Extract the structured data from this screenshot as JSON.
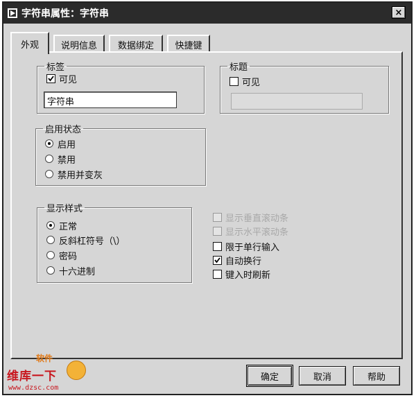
{
  "window": {
    "title": "字符串属性：字符串",
    "close_glyph": "×"
  },
  "tabs": [
    {
      "label": "外观"
    },
    {
      "label": "说明信息"
    },
    {
      "label": "数据绑定"
    },
    {
      "label": "快捷键"
    }
  ],
  "label_group": {
    "legend": "标签",
    "visible_label": "可见",
    "visible_checked": true,
    "value": "字符串"
  },
  "caption_group": {
    "legend": "标题",
    "visible_label": "可见",
    "visible_checked": false,
    "value": ""
  },
  "enable_group": {
    "legend": "启用状态",
    "options": [
      "启用",
      "禁用",
      "禁用并变灰"
    ],
    "selected": "启用"
  },
  "display_group": {
    "legend": "显示样式",
    "options": [
      "正常",
      "反斜杠符号（\\）",
      "密码",
      "十六进制"
    ],
    "selected": "正常"
  },
  "options": [
    {
      "label": "显示垂直滚动条",
      "checked": false,
      "enabled": false
    },
    {
      "label": "显示水平滚动条",
      "checked": false,
      "enabled": false
    },
    {
      "label": "限于单行输入",
      "checked": false,
      "enabled": true
    },
    {
      "label": "自动换行",
      "checked": true,
      "enabled": true
    },
    {
      "label": "键入时刷新",
      "checked": false,
      "enabled": true
    }
  ],
  "buttons": {
    "ok": "确定",
    "cancel": "取消",
    "help": "帮助"
  },
  "watermark": {
    "top": "软件",
    "brand": "维库一下",
    "url": "www.dzsc.com"
  }
}
